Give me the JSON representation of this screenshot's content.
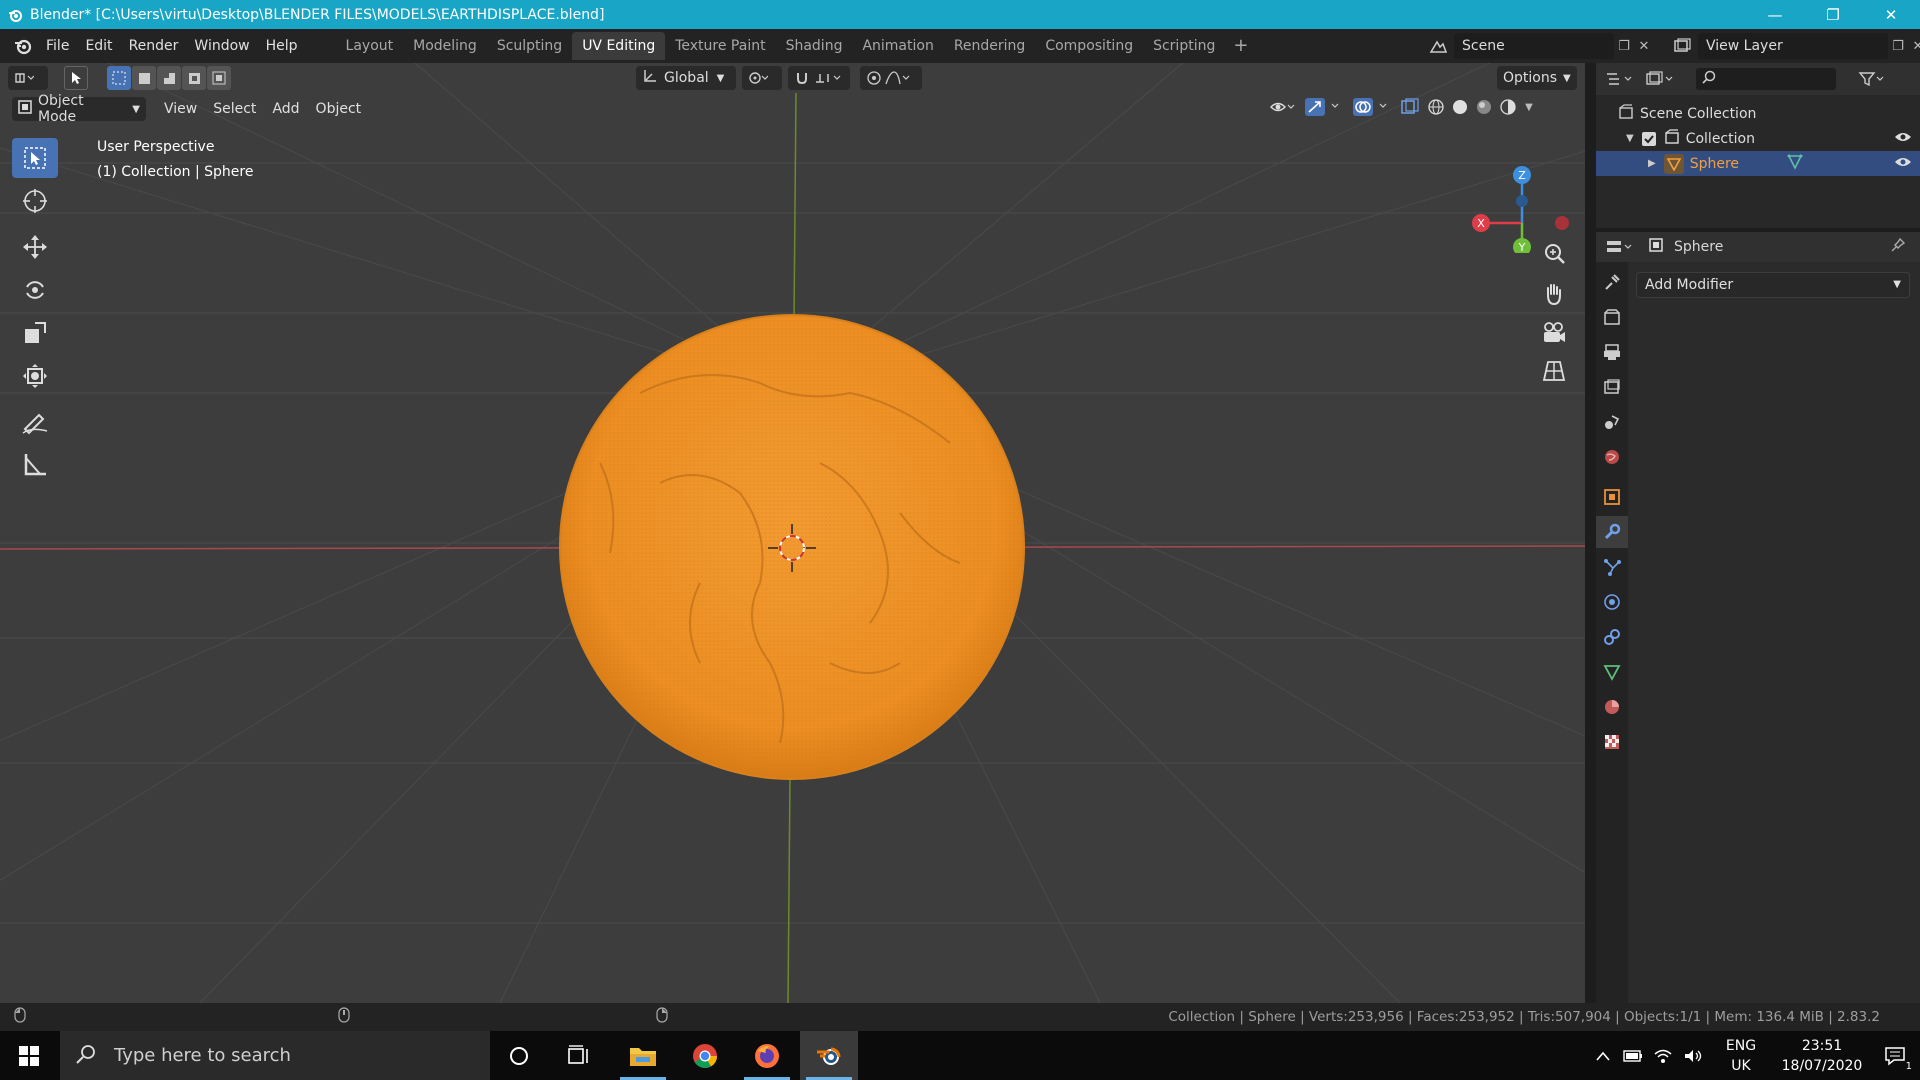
{
  "window": {
    "title": "Blender* [C:\\Users\\virtu\\Desktop\\BLENDER FILES\\MODELS\\EARTHDISPLACE.blend]",
    "controls": [
      "minimize-icon",
      "restore-icon",
      "close-icon"
    ]
  },
  "menubar": {
    "menus": [
      "File",
      "Edit",
      "Render",
      "Window",
      "Help"
    ],
    "tabs": [
      "Layout",
      "Modeling",
      "Sculpting",
      "UV Editing",
      "Texture Paint",
      "Shading",
      "Animation",
      "Rendering",
      "Compositing",
      "Scripting"
    ],
    "active_tab": "UV Editing",
    "add_tab": "+",
    "scene": "Scene",
    "view_layer": "View Layer"
  },
  "viewport": {
    "header": {
      "transform_orientation": "Global",
      "options": "Options"
    },
    "header2": {
      "mode": "Object Mode",
      "menus": [
        "View",
        "Select",
        "Add",
        "Object"
      ]
    },
    "info_line1": "User Perspective",
    "info_line2": "(1) Collection | Sphere",
    "gizmo": {
      "z": "Z",
      "y": "Y",
      "x": "X"
    }
  },
  "outliner": {
    "rows": [
      {
        "label": "Scene Collection"
      },
      {
        "label": "Collection"
      },
      {
        "label": "Sphere"
      }
    ]
  },
  "properties": {
    "object_name": "Sphere",
    "add_modifier": "Add Modifier"
  },
  "statusbar": {
    "text": "Collection | Sphere | Verts:253,956 | Faces:253,952 | Tris:507,904 | Objects:1/1 | Mem: 136.4 MiB | 2.83.2"
  },
  "taskbar": {
    "search_placeholder": "Type here to search",
    "lang1": "ENG",
    "lang2": "UK",
    "time": "23:51",
    "date": "18/07/2020",
    "notification_count": "1"
  },
  "colors": {
    "titlebar": "#19a6c6",
    "viewport_bg": "#3d3d3d",
    "selection_blue": "#4772b3",
    "sphere_orange": "#f0962a"
  }
}
